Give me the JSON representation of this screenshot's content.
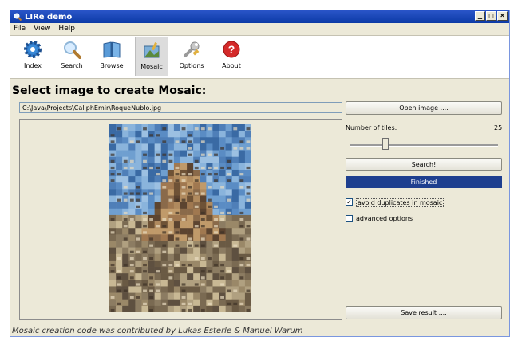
{
  "window": {
    "title": "LIRe demo",
    "controls": [
      "_",
      "□",
      "×"
    ]
  },
  "menu": [
    "File",
    "View",
    "Help"
  ],
  "toolbar": {
    "items": [
      {
        "label": "Index",
        "icon": "gear-icon"
      },
      {
        "label": "Search",
        "icon": "magnifier-icon"
      },
      {
        "label": "Browse",
        "icon": "book-icon"
      },
      {
        "label": "Mosaic",
        "icon": "mosaic-icon",
        "active": true
      },
      {
        "label": "Options",
        "icon": "wrench-icon"
      },
      {
        "label": "About",
        "icon": "help-icon"
      }
    ]
  },
  "heading": "Select image to create Mosaic:",
  "path": "C:\\Java\\Projects\\CaliphEmir\\RoqueNublo.jpg",
  "open_button": "Open image ....",
  "tiles": {
    "label": "Number of tiles:",
    "value": "25",
    "slider_fraction": 0.25
  },
  "search_button": "Search!",
  "progress": {
    "label": "Finished",
    "fraction": 1.0
  },
  "options": {
    "avoid_duplicates": {
      "label": "avoid duplicates in mosaic",
      "checked": true
    },
    "advanced": {
      "label": "advanced options",
      "checked": false
    }
  },
  "save_button": "Save result ....",
  "footer": "Mosaic creation code was contributed by Lukas Esterle & Manuel Warum",
  "colors": {
    "titlebar": "#0b3aa6",
    "progress": "#1e3f8f",
    "background": "#ece9d8"
  }
}
